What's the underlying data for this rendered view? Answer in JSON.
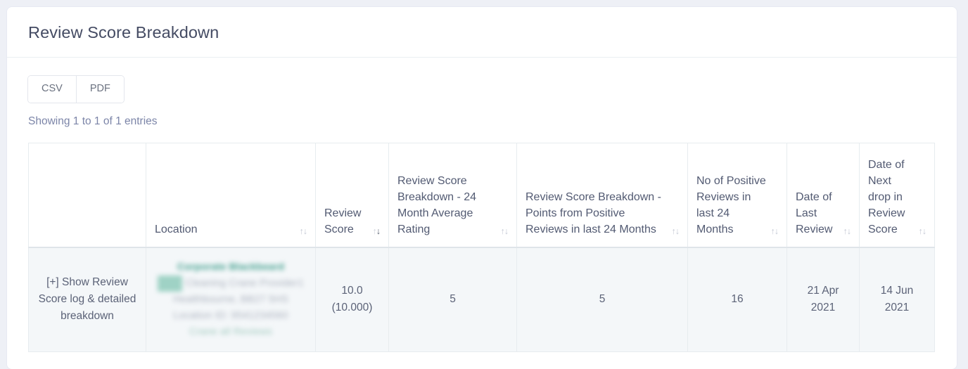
{
  "card": {
    "title": "Review Score Breakdown"
  },
  "toolbar": {
    "buttons": [
      {
        "label": "CSV",
        "name": "csv-export-button"
      },
      {
        "label": "PDF",
        "name": "pdf-export-button"
      }
    ]
  },
  "table_info": "Showing 1 to 1 of 1 entries",
  "table": {
    "columns": [
      {
        "label": "",
        "sortable": false,
        "sort_state": "none"
      },
      {
        "label": "Location",
        "sortable": true,
        "sort_state": "none"
      },
      {
        "label": "Review Score",
        "sortable": true,
        "sort_state": "desc"
      },
      {
        "label": "Review Score Breakdown - 24 Month Average Rating",
        "sortable": true,
        "sort_state": "none"
      },
      {
        "label": "Review Score Breakdown - Points from Positive Reviews in last 24 Months",
        "sortable": true,
        "sort_state": "none"
      },
      {
        "label": "No of Positive Reviews in last 24 Months",
        "sortable": true,
        "sort_state": "none"
      },
      {
        "label": "Date of Last Review",
        "sortable": true,
        "sort_state": "none"
      },
      {
        "label": "Date of Next drop in Review Score",
        "sortable": true,
        "sort_state": "none"
      }
    ],
    "sort_icon": "↑↓",
    "rows": [
      {
        "expand_label": "[+] Show Review Score log & detailed breakdown",
        "location": {
          "redacted": true,
          "link_line": "Corporate Blackbeard",
          "badge": "Ltd",
          "line2": "Cleaning Crane Provider1",
          "line3": "Healthbourne, BB27 5HS",
          "line4": "Location ID: 9541234560",
          "line5": "Crane all Reviews"
        },
        "review_score": "10.0 (10.000)",
        "avg_rating_24m": "5",
        "points_positive_24m": "5",
        "positive_reviews_24m": "16",
        "date_last_review": "21 Apr 2021",
        "date_next_drop": "14 Jun 2021"
      }
    ]
  },
  "colors": {
    "page_background": "#eef0f6",
    "card_background": "#ffffff",
    "title_text": "#444b63",
    "header_text": "#525a72",
    "body_text": "#5b6277",
    "info_text": "#7c85a8",
    "row_background": "#f4f7f9",
    "border": "#e7ecef",
    "redacted_link": "#3f9e8c"
  }
}
